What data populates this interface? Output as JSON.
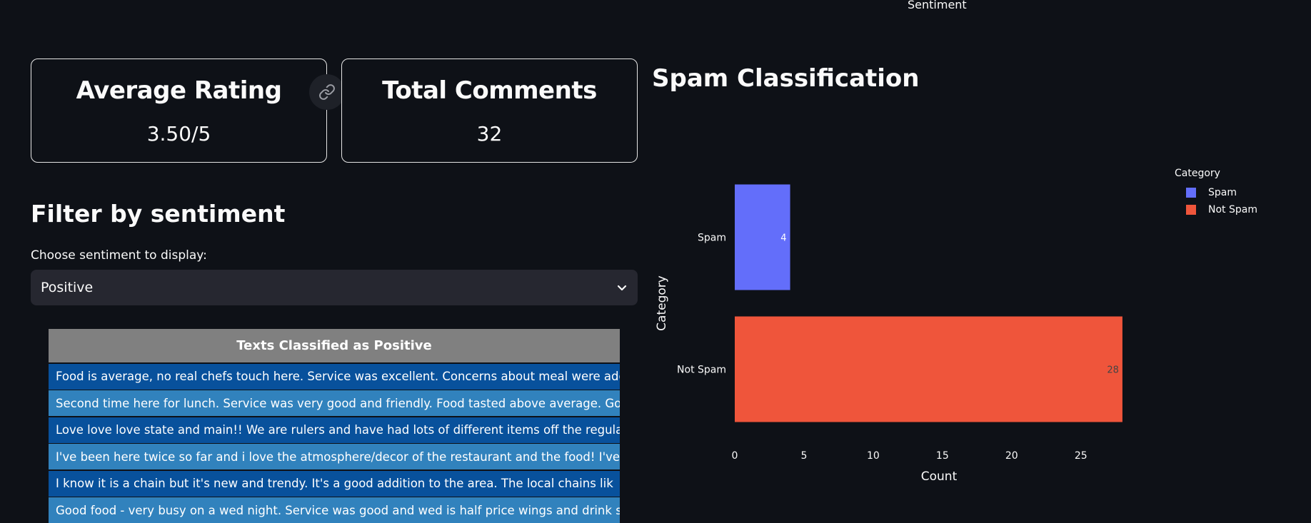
{
  "top_fragment": "Sentiment",
  "metrics": [
    {
      "title": "Average Rating",
      "value": "3.50/5"
    },
    {
      "title": "Total Comments",
      "value": "32"
    }
  ],
  "filter": {
    "heading": "Filter by sentiment",
    "label": "Choose sentiment to display:",
    "selected": "Positive"
  },
  "table": {
    "header": "Texts Classified as Positive",
    "rows": [
      "Food is average, no real chefs touch here. Service was excellent. Concerns about meal were addressed",
      "Second time here for lunch.  Service was very good and friendly.  Food tasted above average.  Good p",
      "Love love love state and main!! We are rulers and have had lots of different items off the regular m",
      "I've been here twice so far and i love the atmosphere/decor of the restaurant and the food! I've tri",
      "I know it is a chain but it's new and trendy. It's a good addition to the area. The local chains lik",
      "Good food - very busy on a wed night.  Service was good and wed is half price wings and drink specia"
    ]
  },
  "chart_data": {
    "type": "bar",
    "orientation": "horizontal",
    "title": "Spam Classification",
    "categories": [
      "Spam",
      "Not Spam"
    ],
    "values": [
      4,
      28
    ],
    "colors": [
      "#636efa",
      "#ef553b"
    ],
    "xlabel": "Count",
    "ylabel": "Category",
    "xticks": [
      0,
      5,
      10,
      15,
      20,
      25
    ],
    "xlim": [
      0,
      29.5
    ],
    "legend": {
      "title": "Category",
      "items": [
        "Spam",
        "Not Spam"
      ],
      "placement": "top-right"
    },
    "grid": false
  }
}
